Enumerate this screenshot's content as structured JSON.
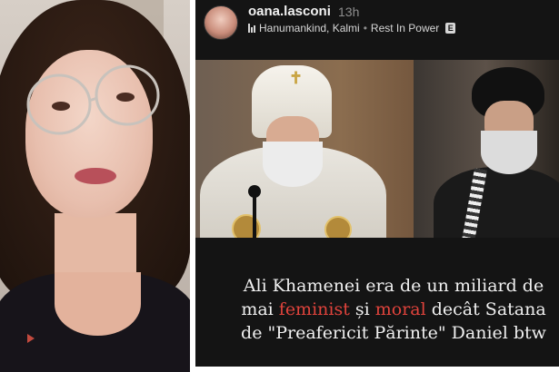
{
  "post": {
    "username": "oana.lasconi",
    "time": "13h",
    "music": "Hanumankind, Kalmi",
    "separator": "•",
    "song": "Rest In Power",
    "explicit_badge": "E"
  },
  "caption": {
    "line1": "Ali Khamenei era de un miliard de",
    "line2_part1": "mai ",
    "line2_word1": "feminist",
    "line2_part2": " și ",
    "line2_word2": "moral",
    "line2_part3": " decât Satana",
    "line3": "de \"Preafericit Părinte\" Daniel btw",
    "highlight_color": "#e0433c"
  },
  "icons": [
    "music-bars-icon",
    "cross-icon"
  ]
}
